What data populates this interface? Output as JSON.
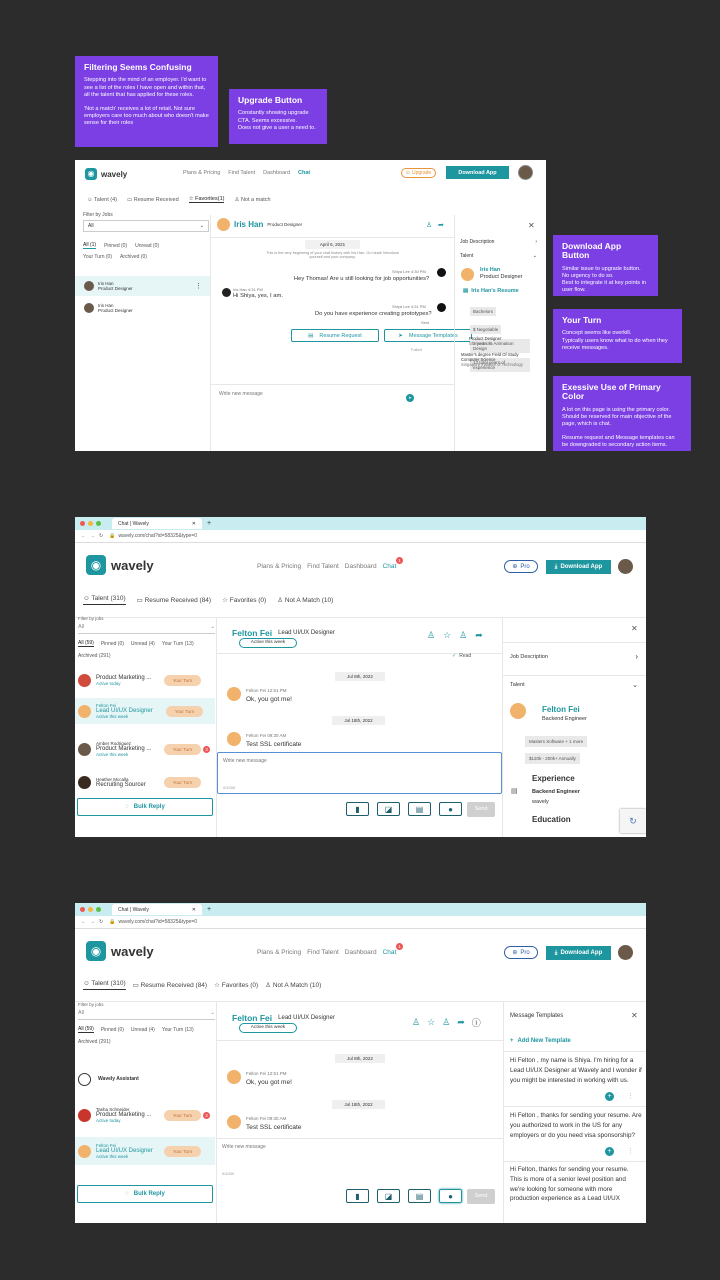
{
  "notes": {
    "filtering": {
      "title": "Filtering Seems Confusing",
      "body": "Stepping into the mind of an employer. I'd want to see a list of the roles I have open and within that, all the talent that has applied for these roles.\n\n'Not a match' receives a lot of retail. Not sure employers care too much about who doesn't make sense for their roles"
    },
    "upgrade": {
      "title": "Upgrade Button",
      "body": "Constantly showing upgrade CTA. Seems excessive.\nDoes not give a user a need to."
    },
    "download": {
      "title": "Download App Button",
      "body": "Similar issue to upgrade button.\nNo urgency to do so.\nBest to integrate it at key points in user flow."
    },
    "yourturn": {
      "title": "Your Turn",
      "body": "Concept seems like overkill.\nTypically users know what to do when they receive messages."
    },
    "primary": {
      "title": "Exessive Use of Primary Color",
      "body": "A lot on this page is using the primary color. Should be reserved for main objective of the page, which is chat.\n\nResume request and Message templates can be downgraded to secondary action items."
    }
  },
  "shot1": {
    "logo": "wavely",
    "nav": [
      "Plans & Pricing",
      "Find Talent",
      "Dashboard",
      "Chat"
    ],
    "upgrade": "Upgrade",
    "download": "Download App",
    "tabs": [
      "Talent (4)",
      "Resume Received",
      "Favorites(1)",
      "Not a match"
    ],
    "filter_label": "Filter by Jobs",
    "filter_value": "All",
    "subtabs": [
      "All (1)",
      "Pinned (0)",
      "Unread (0)"
    ],
    "subtabs2": [
      "Your Turn (0)",
      "Archived (0)"
    ],
    "list": [
      {
        "name": "Iris Han",
        "role": "Product Designer"
      },
      {
        "name": "Iris Han",
        "role": "Product Designer"
      }
    ],
    "chat_name": "Iris Han",
    "chat_role": "Product Designer",
    "date": "April 6, 2021",
    "intro": "This is the very beginning of your chat history with Iris Han. Go head! Introduce yourself and your company.",
    "m1_meta": "Shiya Lee  4:30 PM",
    "m1": "Hey Thomas! Are u still looking for job opportunities?",
    "m2_meta": "Iris Han  4:31 PM",
    "m2": "Hi Shiya, yes, I am.",
    "m3_meta": "Shiya Lee  4:31 PM",
    "m3": "Do you have experience creating prototypes?",
    "m3_status": "Sent",
    "m4_status": "Failed",
    "resume_request": "Resume Request",
    "message_templates": "Message Templates",
    "input_placeholder": "Write new message",
    "side_job": "Job Description",
    "side_talent": "Talent",
    "side_name": "Iris Han",
    "side_role": "Product Designer",
    "resume_link": "Iris Han's Resume",
    "side_tags": [
      "Bachelors",
      "$ Negotiable",
      "2 years in Animation Design",
      "13 total years of experience"
    ],
    "edu1": "Product Designer",
    "edu1b": "Shelanda IN",
    "edu2": "Master's degree Field Of Study",
    "edu2b": "Computer Science",
    "edu2c": "Singapore Institute of Technology"
  },
  "shot2": {
    "tab_title": "Chat | Wavely",
    "url": "wavely.com/chat?id=58325&type=0",
    "logo": "wavely",
    "nav": [
      "Plans & Pricing",
      "Find Talent",
      "Dashboard",
      "Chat"
    ],
    "chat_badge": "1",
    "pro": "Pro",
    "download": "Download App",
    "tabs": [
      "Talent (310)",
      "Resume Received (84)",
      "Favorites (0)",
      "Not A Match (10)"
    ],
    "filter_label": "Filter by jobs",
    "filter_value": "All",
    "subtabs": [
      "All (59)",
      "Pinned (0)",
      "Unread (4)",
      "Your Turn (13)"
    ],
    "archived": "Archived (291)",
    "list": [
      {
        "name": "",
        "role": "Product Marketing ...",
        "status": "Active today",
        "pill": "Your Turn"
      },
      {
        "name": "Felton Fei",
        "role": "Lead UI/UX Designer",
        "status": "Active this week",
        "pill": "Your Turn"
      },
      {
        "name": "Amber Rodriguez",
        "role": "Product Marketing ...",
        "status": "Active this week",
        "pill": "Your Turn",
        "badge": "3"
      },
      {
        "name": "Heather Mccalla",
        "role": "Recruiting Sourcer",
        "status": "",
        "pill": "Your Turn"
      }
    ],
    "bulk": "Bulk Reply",
    "chat_name": "Felton Fei",
    "chat_role": "Lead UI/UX Designer",
    "active": "Active this week",
    "read": "Read",
    "date1": "Jul 8th, 2022",
    "m1_meta": "Felton Fei  12:51 PM",
    "m1": "Ok, you got me!",
    "date2": "Jul 18th, 2022",
    "m2_meta": "Felton Fei  09:30 AM",
    "m2": "Test SSL certificate",
    "input_placeholder": "Write new message",
    "counter": "0/1000",
    "send": "Send",
    "side_job": "Job Description",
    "side_talent": "Talent",
    "side_name": "Felton Fei",
    "side_role": "Backend Engineer",
    "tags": [
      "Masters Software + 1 more",
      "$120k - 200k+ Annually"
    ],
    "exp": "Experience",
    "exp_role": "Backend Engineer",
    "exp_co": "wavely",
    "edu": "Education"
  },
  "shot3": {
    "tab_title": "Chat | Wavely",
    "url": "wavely.com/chat?id=58325&type=0",
    "logo": "wavely",
    "nav": [
      "Plans & Pricing",
      "Find Talent",
      "Dashboard",
      "Chat"
    ],
    "chat_badge": "1",
    "pro": "Pro",
    "download": "Download App",
    "tabs": [
      "Talent (310)",
      "Resume Received (84)",
      "Favorites (0)",
      "Not A Match (10)"
    ],
    "filter_label": "Filter by jobs",
    "filter_value": "All",
    "subtabs": [
      "All (59)",
      "Pinned (0)",
      "Unread (4)",
      "Your Turn (13)"
    ],
    "archived": "Archived (291)",
    "assistant": "Wavely Assistant",
    "list": [
      {
        "name": "Tasha Schneider",
        "role": "Product Marketing ...",
        "status": "Active today",
        "pill": "Your Turn",
        "badge": "3"
      },
      {
        "name": "Felton Fei",
        "role": "Lead UI/UX Designer",
        "status": "Active this week",
        "pill": "Your Turn"
      }
    ],
    "bulk": "Bulk Reply",
    "chat_name": "Felton Fei",
    "chat_role": "Lead UI/UX Designer",
    "active": "Active this week",
    "date1": "Jul 8th, 2022",
    "m1_meta": "Felton Fei  12:51 PM",
    "m1": "Ok, you got me!",
    "date2": "Jul 18th, 2022",
    "m2_meta": "Felton Fei  09:30 AM",
    "m2": "Test SSL certificate",
    "input_placeholder": "Write new message",
    "counter": "0/1000",
    "send": "Send",
    "templates_title": "Message Templates",
    "add_template": "Add New Template",
    "templates": [
      "Hi Felton , my name is Shiya. I'm hiring for a Lead UI/UX Designer at Wavely and I wonder if you might be interested in working with us.",
      "Hi Felton , thanks for sending your resume. Are you authorized to work in the US for any employers or do you need visa sponsorship?",
      "Hi Felton, thanks for sending your resume. This is more of a senior level position and we're looking for someone with more production experience as a Lead UI/UX"
    ]
  }
}
